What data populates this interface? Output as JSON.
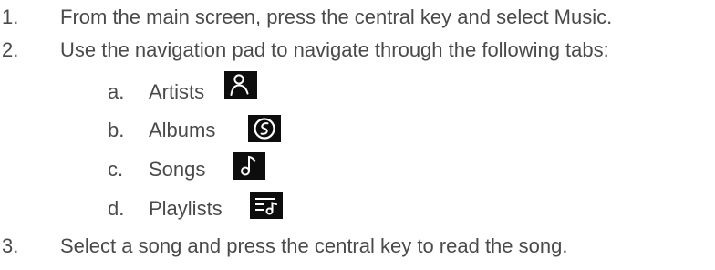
{
  "steps": [
    {
      "number": "1.",
      "text": "From the main screen, press the central key and select Music."
    },
    {
      "number": "2.",
      "text": "Use the navigation pad to navigate through the following tabs:"
    },
    {
      "number": "3.",
      "text": "Select a song and press the central key to read the song."
    }
  ],
  "tabs": [
    {
      "letter": "a.",
      "label": "Artists",
      "icon": "artist-person-icon"
    },
    {
      "letter": "b.",
      "label": "Albums",
      "icon": "album-disc-icon"
    },
    {
      "letter": "c.",
      "label": "Songs",
      "icon": "music-note-icon"
    },
    {
      "letter": "d.",
      "label": "Playlists",
      "icon": "playlist-icon"
    }
  ],
  "colors": {
    "text": "#4a4a4a",
    "icon_background": "#0d0d0d",
    "icon_foreground": "#ffffff"
  }
}
